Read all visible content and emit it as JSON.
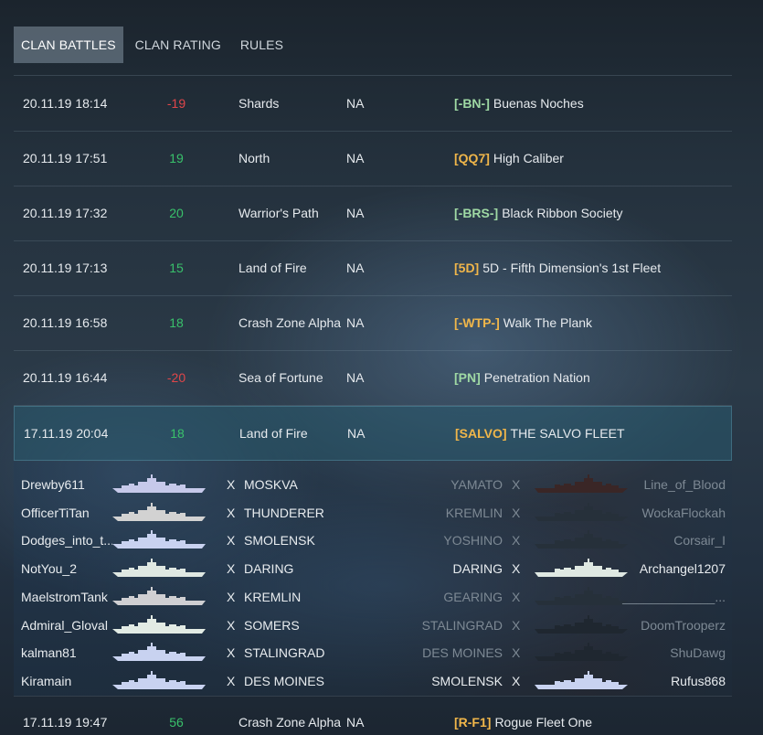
{
  "tabs": [
    {
      "label": "CLAN BATTLES",
      "active": true
    },
    {
      "label": "CLAN RATING",
      "active": false
    },
    {
      "label": "RULES",
      "active": false
    }
  ],
  "colors": {
    "positive": "#39c16b",
    "negative": "#e0464a",
    "clan_tag": "#f0b64a",
    "tag_green": "#9fd9a4"
  },
  "battles": [
    {
      "date": "20.11.19 18:14",
      "score": "-19",
      "map": "Shards",
      "realm": "NA",
      "tag": "[-BN-]",
      "tag_color": "#9fd9a4",
      "clan": "Buenas Noches"
    },
    {
      "date": "20.11.19 17:51",
      "score": "19",
      "map": "North",
      "realm": "NA",
      "tag": "[QQ7]",
      "tag_color": "#f0b64a",
      "clan": "High Caliber"
    },
    {
      "date": "20.11.19 17:32",
      "score": "20",
      "map": "Warrior's Path",
      "realm": "NA",
      "tag": "[-BRS-]",
      "tag_color": "#9fd9a4",
      "clan": "Black Ribbon Society"
    },
    {
      "date": "20.11.19 17:13",
      "score": "15",
      "map": "Land of Fire",
      "realm": "NA",
      "tag": "[5D]",
      "tag_color": "#f0b64a",
      "clan": "5D - Fifth Dimension's 1st Fleet"
    },
    {
      "date": "20.11.19 16:58",
      "score": "18",
      "map": "Crash Zone Alpha",
      "realm": "NA",
      "tag": "[-WTP-]",
      "tag_color": "#f0b64a",
      "clan": "Walk The Plank"
    },
    {
      "date": "20.11.19 16:44",
      "score": "-20",
      "map": "Sea of Fortune",
      "realm": "NA",
      "tag": "[PN]",
      "tag_color": "#9fd9a4",
      "clan": "Penetration Nation"
    },
    {
      "date": "17.11.19 20:04",
      "score": "18",
      "map": "Land of Fire",
      "realm": "NA",
      "tag": "[SALVO]",
      "tag_color": "#f0b64a",
      "clan": "THE SALVO FLEET"
    }
  ],
  "detail": {
    "x_mark": "X",
    "left": [
      {
        "player": "Drewby611",
        "ship": "MOSKVA",
        "ship_color": "#c6c9ea"
      },
      {
        "player": "OfficerTiTan",
        "ship": "THUNDERER",
        "ship_color": "#d2d2d2"
      },
      {
        "player": "Dodges_into_t...",
        "ship": "SMOLENSK",
        "ship_color": "#c8d2f0"
      },
      {
        "player": "NotYou_2",
        "ship": "DARING",
        "ship_color": "#dfe8e2"
      },
      {
        "player": "MaelstromTank",
        "ship": "KREMLIN",
        "ship_color": "#cfcfd2"
      },
      {
        "player": "Admiral_Gloval",
        "ship": "SOMERS",
        "ship_color": "#e2ebe4"
      },
      {
        "player": "kalman81",
        "ship": "STALINGRAD",
        "ship_color": "#c8d2f0"
      },
      {
        "player": "Kiramain",
        "ship": "DES MOINES",
        "ship_color": "#c8d2f0"
      }
    ],
    "right": [
      {
        "ship": "YAMATO",
        "player": "Line_of_Blood",
        "alive": false,
        "ship_color": "#3a2626"
      },
      {
        "ship": "KREMLIN",
        "player": "WockaFlockah",
        "alive": false,
        "ship_color": "#26303a"
      },
      {
        "ship": "YOSHINO",
        "player": "Corsair_I",
        "alive": false,
        "ship_color": "#26303a"
      },
      {
        "ship": "DARING",
        "player": "Archangel1207",
        "alive": true,
        "ship_color": "#dfe8e2"
      },
      {
        "ship": "GEARING",
        "player": "_____________...",
        "alive": false,
        "ship_color": "#26303a"
      },
      {
        "ship": "STALINGRAD",
        "player": "DoomTrooperz",
        "alive": false,
        "ship_color": "#1f2730"
      },
      {
        "ship": "DES MOINES",
        "player": "ShuDawg",
        "alive": false,
        "ship_color": "#1f2730"
      },
      {
        "ship": "SMOLENSK",
        "player": "Rufus868",
        "alive": true,
        "ship_color": "#c8d2f0"
      }
    ]
  },
  "last_battle": {
    "date": "17.11.19 19:47",
    "score": "56",
    "map": "Crash Zone Alpha",
    "realm": "NA",
    "tag": "[R-F1]",
    "tag_color": "#f0b64a",
    "clan": "Rogue Fleet One"
  }
}
